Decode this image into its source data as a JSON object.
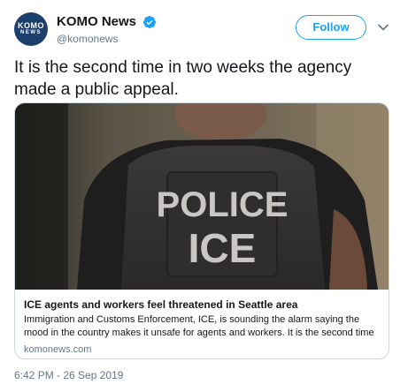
{
  "header": {
    "avatar_line1": "KOMO",
    "avatar_line2": "NEWS",
    "display_name": "KOMO News",
    "handle": "@komonews",
    "follow_label": "Follow"
  },
  "tweet": {
    "text": "It is the second time in two weeks the agency made a public appeal.",
    "timestamp": "6:42 PM - 26 Sep 2019"
  },
  "card": {
    "image_text_line1": "POLICE",
    "image_text_line2": "ICE",
    "title": "ICE agents and workers feel threatened in Seattle area",
    "description": "Immigration and Customs Enforcement, ICE, is sounding the alarm saying the mood in the country makes it unsafe for agents and workers. It is the second time in two ...",
    "domain": "komonews.com"
  },
  "colors": {
    "accent": "#1da1f2",
    "secondary_text": "#657786",
    "card_border": "#ccd6dd"
  },
  "icons": [
    "verified-badge-icon",
    "chevron-down-icon"
  ]
}
